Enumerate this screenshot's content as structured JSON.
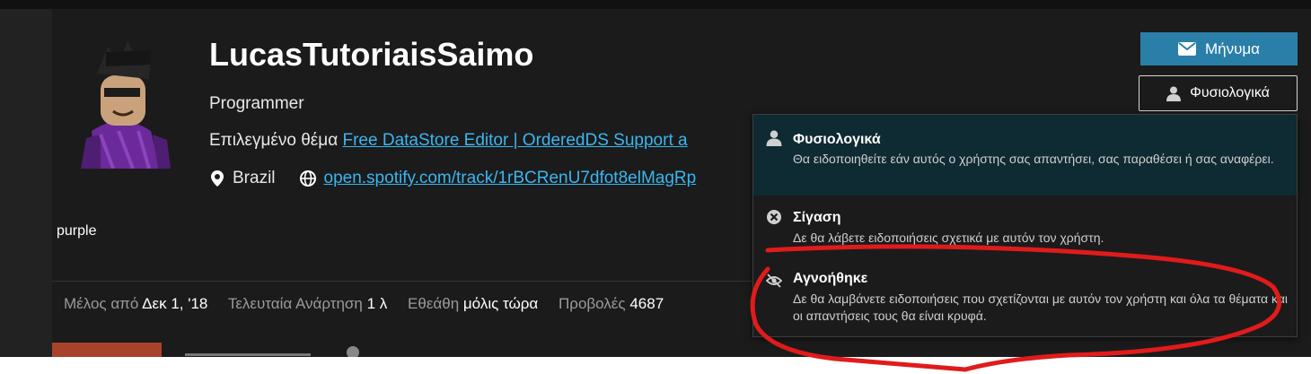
{
  "profile": {
    "username": "LucasTutoriaisSaimo",
    "title": "Programmer",
    "featured_label": "Επιλεγμένο θέμα",
    "featured_link": "Free DataStore Editor | OrderedDS Support a",
    "location": "Brazil",
    "website": "open.spotify.com/track/1rBCRenU7dfot8elMagRp",
    "bio": "purple"
  },
  "stats": {
    "member_label": "Μέλος από",
    "member_value": "Δεκ 1, '18",
    "last_post_label": "Τελευταία Ανάρτηση",
    "last_post_value": "1 λ",
    "seen_label": "Εθεάθη",
    "seen_value": "μόλις τώρα",
    "views_label": "Προβολές",
    "views_value": "4687"
  },
  "actions": {
    "message_label": "Μήνυμα",
    "notify_label": "Φυσιολογικά"
  },
  "notification_menu": {
    "options": [
      {
        "title": "Φυσιολογικά",
        "description": "Θα ειδοποιηθείτε εάν αυτός ο χρήστης σας απαντήσει, σας παραθέσει ή σας αναφέρει.",
        "icon": "user-icon",
        "selected": true
      },
      {
        "title": "Σίγαση",
        "description": "Δε θα λάβετε ειδοποιήσεις σχετικά με αυτόν τον χρήστη.",
        "icon": "times-circle-icon",
        "selected": false
      },
      {
        "title": "Αγνοήθηκε",
        "description": "Δε θα λαμβάνετε ειδοποιήσεις που σχετίζονται με αυτόν τον χρήστη και όλα τα θέματα και οι απαντήσεις τους θα είναι κρυφά.",
        "icon": "eye-slash-icon",
        "selected": false
      }
    ]
  },
  "colors": {
    "accent": "#2a7fa8",
    "link": "#3ab6f0",
    "active_tab": "#a8432b",
    "selected_option": "#0e2a33",
    "annotation": "#e01b1b"
  }
}
